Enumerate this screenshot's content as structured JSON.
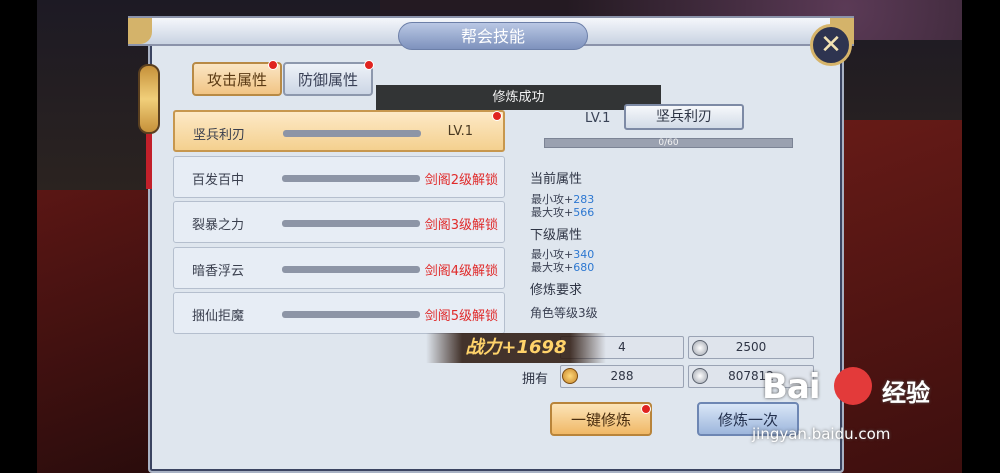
{
  "window": {
    "title": "帮会技能",
    "close_glyph": "✕"
  },
  "tabs": [
    {
      "label": "攻击属性",
      "active": true,
      "badge": true
    },
    {
      "label": "防御属性",
      "active": false,
      "badge": true
    }
  ],
  "toast": "修炼成功",
  "skills": [
    {
      "name": "坚兵利刃",
      "status": "LV.1",
      "selected": true,
      "badge": true
    },
    {
      "name": "百发百中",
      "status": "剑阁2级解锁",
      "selected": false
    },
    {
      "name": "裂暴之力",
      "status": "剑阁3级解锁",
      "selected": false
    },
    {
      "name": "暗香浮云",
      "status": "剑阁4级解锁",
      "selected": false
    },
    {
      "name": "捆仙拒魔",
      "status": "剑阁5级解锁",
      "selected": false
    }
  ],
  "detail": {
    "level": "LV.1",
    "name": "坚兵利刃",
    "progress_text": "0/60",
    "current_title": "当前属性",
    "current": [
      {
        "label": "最小攻+",
        "value": "283"
      },
      {
        "label": "最大攻+",
        "value": "566"
      }
    ],
    "next_title": "下级属性",
    "next": [
      {
        "label": "最小攻+",
        "value": "340"
      },
      {
        "label": "最大攻+",
        "value": "680"
      }
    ],
    "req_title": "修炼要求",
    "req_text": "角色等级3级"
  },
  "cost": {
    "gold": "4",
    "silver": "2500"
  },
  "owned": {
    "label": "拥有",
    "gold": "288",
    "silver": "807812"
  },
  "power_text": "战力+1698",
  "buttons": {
    "one_key": "一键修炼",
    "once": "修炼一次"
  },
  "watermark": {
    "logo": "Bai",
    "logo2": "经验",
    "url": "jingyan.baidu.com"
  }
}
